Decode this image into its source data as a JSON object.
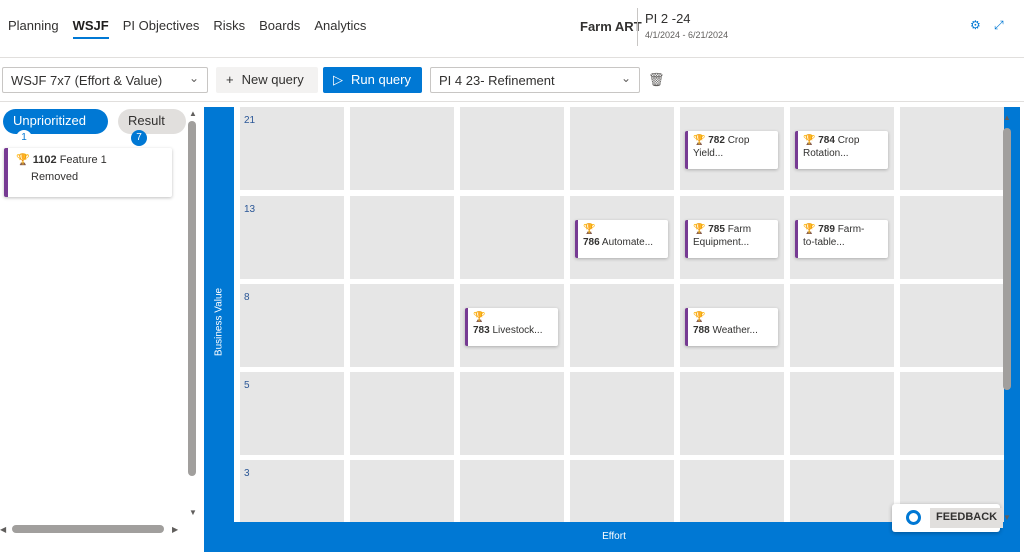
{
  "tabs": [
    "Planning",
    "WSJF",
    "PI Objectives",
    "Risks",
    "Boards",
    "Analytics"
  ],
  "active_tab": "WSJF",
  "header": {
    "art": "Farm ART",
    "pi": "PI 2 -24",
    "dates": "4/1/2024 - 6/21/2024",
    "settings_icon": "gear-icon",
    "expand_icon": "expand-icon"
  },
  "toolbar": {
    "wsjf_dropdown": "WSJF 7x7 (Effort & Value)",
    "new_query": "New query",
    "run_query": "Run query",
    "query_dropdown": "PI 4 23- Refinement",
    "delete_icon": "trash-icon"
  },
  "left": {
    "unprioritized_label": "Unprioritized",
    "unprioritized_count": "1",
    "result_label": "Result",
    "result_count": "7",
    "card": {
      "id": "1102",
      "title": "Feature 1",
      "status": "Removed"
    }
  },
  "matrix": {
    "y_axis_label": "Business Value",
    "x_axis_label": "Effort",
    "rows": [
      "21",
      "13",
      "8",
      "5",
      "3"
    ],
    "cards": [
      {
        "id": "782",
        "line1": "Crop",
        "line2": "Yield...",
        "row": 0,
        "col": 4
      },
      {
        "id": "784",
        "line1": "Crop",
        "line2": "Rotation...",
        "row": 0,
        "col": 5
      },
      {
        "id": "786",
        "line1": "Automate...",
        "line2": "",
        "row": 1,
        "col": 3
      },
      {
        "id": "785",
        "line1": "Farm",
        "line2": "Equipment...",
        "row": 1,
        "col": 4
      },
      {
        "id": "789",
        "line1": "Farm-",
        "line2": "to-table...",
        "row": 1,
        "col": 5
      },
      {
        "id": "783",
        "line1": "Livestock...",
        "line2": "",
        "row": 2,
        "col": 2
      },
      {
        "id": "788",
        "line1": "Weather...",
        "line2": "",
        "row": 2,
        "col": 4
      }
    ]
  },
  "feedback": {
    "label": "FEEDBACK",
    "icon": "lifebuoy-icon"
  },
  "accent": "#0078d4",
  "card_color": "#773b93"
}
